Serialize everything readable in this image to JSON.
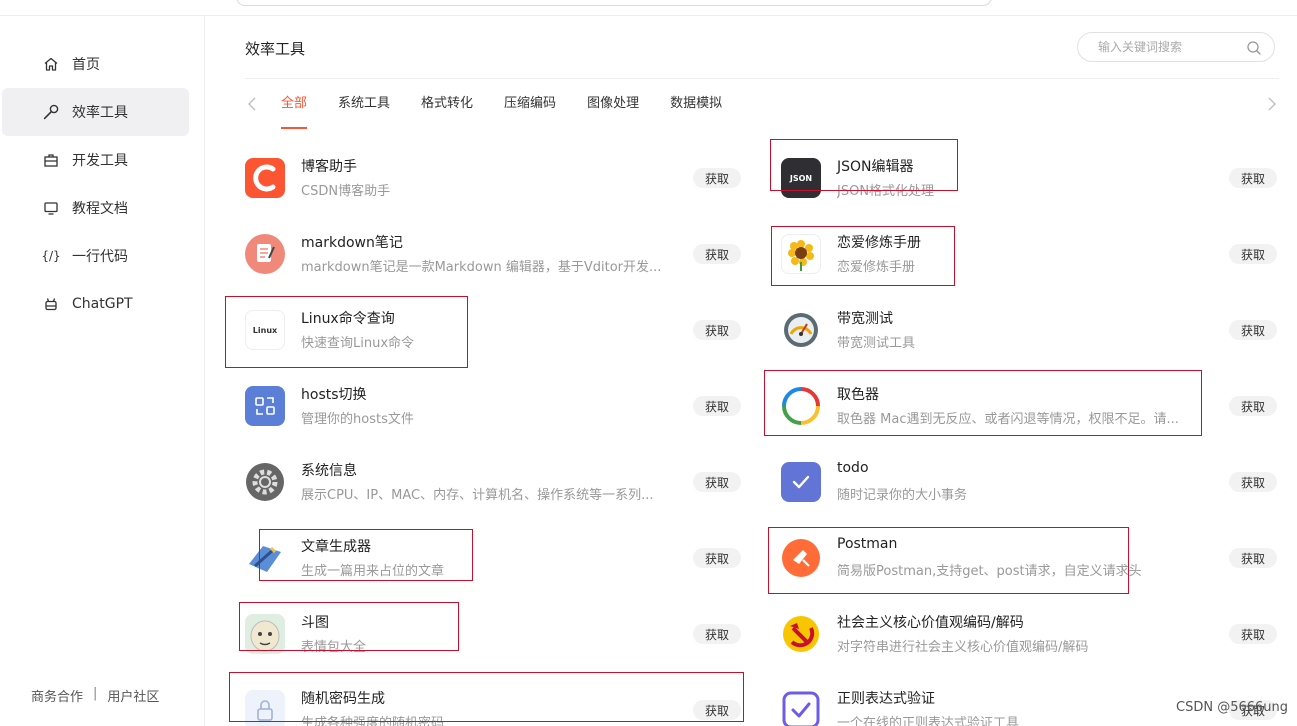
{
  "sidebar": {
    "items": [
      {
        "label": "首页",
        "icon": "home-icon",
        "active": false
      },
      {
        "label": "效率工具",
        "icon": "wrench-icon",
        "active": true
      },
      {
        "label": "开发工具",
        "icon": "briefcase-icon",
        "active": false
      },
      {
        "label": "教程文档",
        "icon": "monitor-icon",
        "active": false
      },
      {
        "label": "一行代码",
        "icon": "code-braces-icon",
        "active": false
      },
      {
        "label": "ChatGPT",
        "icon": "robot-icon",
        "active": false
      }
    ],
    "footer": {
      "business": "商务合作",
      "separator": "|",
      "community": "用户社区"
    }
  },
  "main": {
    "title": "效率工具",
    "search": {
      "placeholder": "输入关键词搜索"
    },
    "tabs": [
      "全部",
      "系统工具",
      "格式转化",
      "压缩编码",
      "图像处理",
      "数据模拟"
    ],
    "active_tab": "全部"
  },
  "tools": [
    {
      "name": "博客助手",
      "desc": "CSDN博客助手",
      "icon": "csdn-c-icon",
      "button": "获取"
    },
    {
      "name": "JSON编辑器",
      "desc": "JSON格式化处理",
      "icon": "json-icon",
      "icon_text": "JSON",
      "button": "获取"
    },
    {
      "name": "markdown笔记",
      "desc": "markdown笔记是一款Markdown 编辑器，基于Vditor开发...",
      "icon": "notepad-icon",
      "button": "获取"
    },
    {
      "name": "恋爱修炼手册",
      "desc": "恋爱修炼手册",
      "icon": "sunflower-icon",
      "button": "获取"
    },
    {
      "name": "Linux命令查询",
      "desc": "快速查询Linux命令",
      "icon": "linux-icon",
      "icon_text": "Linux",
      "button": "获取"
    },
    {
      "name": "带宽测试",
      "desc": "带宽测试工具",
      "icon": "speedometer-icon",
      "button": "获取"
    },
    {
      "name": "hosts切换",
      "desc": "管理你的hosts文件",
      "icon": "swap-icon",
      "button": "获取"
    },
    {
      "name": "取色器",
      "desc": "取色器 Mac遇到无反应、或者闪退等情况，权限不足。请...",
      "icon": "color-ring-icon",
      "button": "获取"
    },
    {
      "name": "系统信息",
      "desc": "展示CPU、IP、MAC、内存、计算机名、操作系统等一系列...",
      "icon": "gear-icon",
      "button": "获取"
    },
    {
      "name": "todo",
      "desc": "随时记录你的大小事务",
      "icon": "checkmark-icon",
      "button": "获取"
    },
    {
      "name": "文章生成器",
      "desc": "生成一篇用来占位的文章",
      "icon": "pen-paper-icon",
      "button": "获取"
    },
    {
      "name": "Postman",
      "desc": "简易版Postman,支持get、post请求，自定义请求头",
      "icon": "postman-icon",
      "button": "获取"
    },
    {
      "name": "斗图",
      "desc": "表情包大全",
      "icon": "meme-face-icon",
      "button": "获取"
    },
    {
      "name": "社会主义核心价值观编码/解码",
      "desc": "对字符串进行社会主义核心价值观编码/解码",
      "icon": "hammer-sickle-icon",
      "button": "获取"
    },
    {
      "name": "随机密码生成",
      "desc": "生成各种强度的随机密码",
      "icon": "lock-icon",
      "button": "获取"
    },
    {
      "name": "正则表达式验证",
      "desc": "一个在线的正则表达式验证工具",
      "icon": "check-box-icon",
      "button": "获取"
    }
  ],
  "watermark": "CSDN @5666ung",
  "colors": {
    "accent": "#fc5531",
    "highlight_box": "#c8102e",
    "sidebar_active": "#f0f0f2"
  }
}
